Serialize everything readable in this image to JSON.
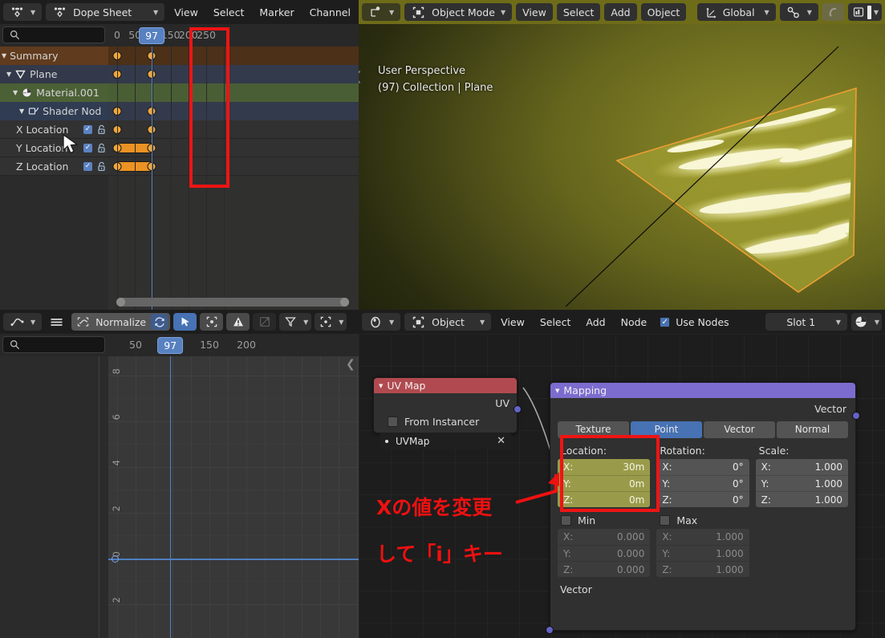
{
  "dope_sheet": {
    "editor_type_icon": "dope-sheet-icon",
    "mode_label": "Dope Sheet",
    "menus": [
      "View",
      "Select",
      "Marker",
      "Channel"
    ],
    "search_placeholder": "",
    "ruler_ticks": [
      "0",
      "50",
      "150",
      "200",
      "250"
    ],
    "current_frame": "97",
    "channels": [
      {
        "label": "Summary",
        "type": "summary",
        "expander": "▼",
        "keys": [
          0,
          97
        ]
      },
      {
        "label": "Plane",
        "type": "object",
        "expander": "▼",
        "icon": "mesh-data-icon",
        "keys": [
          0,
          97
        ]
      },
      {
        "label": "Material.001",
        "type": "material",
        "expander": "▼",
        "icon": "material-icon",
        "keys": []
      },
      {
        "label": "Shader Nod",
        "type": "shader",
        "expander": "▼",
        "icon": "nodetree-icon",
        "keys": [
          0,
          97
        ]
      },
      {
        "label": "X Location",
        "type": "fcurve",
        "checked": true,
        "locked": false,
        "keys": [
          0,
          97
        ]
      },
      {
        "label": "Y Location",
        "type": "fcurve",
        "checked": true,
        "locked": false,
        "keys": [
          0,
          97
        ],
        "bar": [
          0,
          97
        ]
      },
      {
        "label": "Z Location",
        "type": "fcurve",
        "checked": true,
        "locked": false,
        "keys": [
          0,
          97
        ],
        "bar": [
          0,
          97
        ]
      }
    ]
  },
  "viewport": {
    "mode_label": "Object Mode",
    "menus": [
      "View",
      "Select",
      "Add",
      "Object"
    ],
    "transform_orientation": "Global",
    "snap_icon": "snap-magnet-icon",
    "proportional_icon": "proportional-edit-icon",
    "overlay_toggle_icon": "overlays-icon",
    "shading_icon": "shading-modes-icon",
    "info_line_1": "User Perspective",
    "info_line_2": "(97) Collection | Plane",
    "object_outline_color": "#ed9e34"
  },
  "graph_editor": {
    "editor_type_icon": "graph-editor-icon",
    "menu_icon": "hamburger-icon",
    "normalize_label": "Normalize",
    "normalize_refresh_icon": "refresh-icon",
    "filter_icons": [
      "cursor-select-icon",
      "only-selected-icon",
      "errors-icon",
      "ghost-curves-icon",
      "filter-funnel-icon",
      "pivot-icon"
    ],
    "search_placeholder": "",
    "ruler_ticks": [
      "50",
      "150",
      "200"
    ],
    "current_frame": "97",
    "y_axis_ticks": [
      "8",
      "6",
      "4",
      "2",
      "0",
      "2"
    ]
  },
  "shader_editor": {
    "shader_type_icon": "shader-type-icon",
    "context_label": "Object",
    "menus": [
      "View",
      "Select",
      "Add",
      "Node"
    ],
    "use_nodes_label": "Use Nodes",
    "use_nodes_checked": true,
    "slot_label": "Slot 1",
    "material_icon": "material-sphere-icon",
    "nodes": [
      {
        "name": "uv-map-node",
        "title": "UV Map",
        "header_color": "#b14a50",
        "output_socket": "UV",
        "socket_color": "#6363c7",
        "checkbox_label": "From Instancer",
        "checkbox_checked": false,
        "dropdown_value": "UVMap",
        "dropdown_clear_icon": "x-icon"
      },
      {
        "name": "mapping-node",
        "title": "Mapping",
        "header_color": "#7d6ccf",
        "output_socket": "Vector",
        "input_socket": "Vector",
        "socket_color": "#6363c7",
        "vector_type_tabs": [
          "Texture",
          "Point",
          "Vector",
          "Normal"
        ],
        "vector_type_active": "Point",
        "columns": [
          {
            "header": "Location:",
            "highlighted": true,
            "rows": [
              {
                "axis": "X:",
                "value": "30m"
              },
              {
                "axis": "Y:",
                "value": "0m"
              },
              {
                "axis": "Z:",
                "value": "0m"
              }
            ]
          },
          {
            "header": "Rotation:",
            "highlighted": false,
            "rows": [
              {
                "axis": "X:",
                "value": "0°"
              },
              {
                "axis": "Y:",
                "value": "0°"
              },
              {
                "axis": "Z:",
                "value": "0°"
              }
            ]
          },
          {
            "header": "Scale:",
            "highlighted": false,
            "rows": [
              {
                "axis": "X:",
                "value": "1.000"
              },
              {
                "axis": "Y:",
                "value": "1.000"
              },
              {
                "axis": "Z:",
                "value": "1.000"
              }
            ]
          }
        ],
        "clamp": [
          {
            "label": "Min",
            "checked": false,
            "rows": [
              {
                "axis": "X:",
                "value": "0.000"
              },
              {
                "axis": "Y:",
                "value": "0.000"
              },
              {
                "axis": "Z:",
                "value": "0.000"
              }
            ]
          },
          {
            "label": "Max",
            "checked": false,
            "rows": [
              {
                "axis": "X:",
                "value": "1.000"
              },
              {
                "axis": "Y:",
                "value": "1.000"
              },
              {
                "axis": "Z:",
                "value": "1.000"
              }
            ]
          }
        ]
      }
    ]
  },
  "annotations": {
    "highlight_color": "#ef1414",
    "text_line_1": "Xの値を変更",
    "text_line_2": "して「i」キー"
  }
}
